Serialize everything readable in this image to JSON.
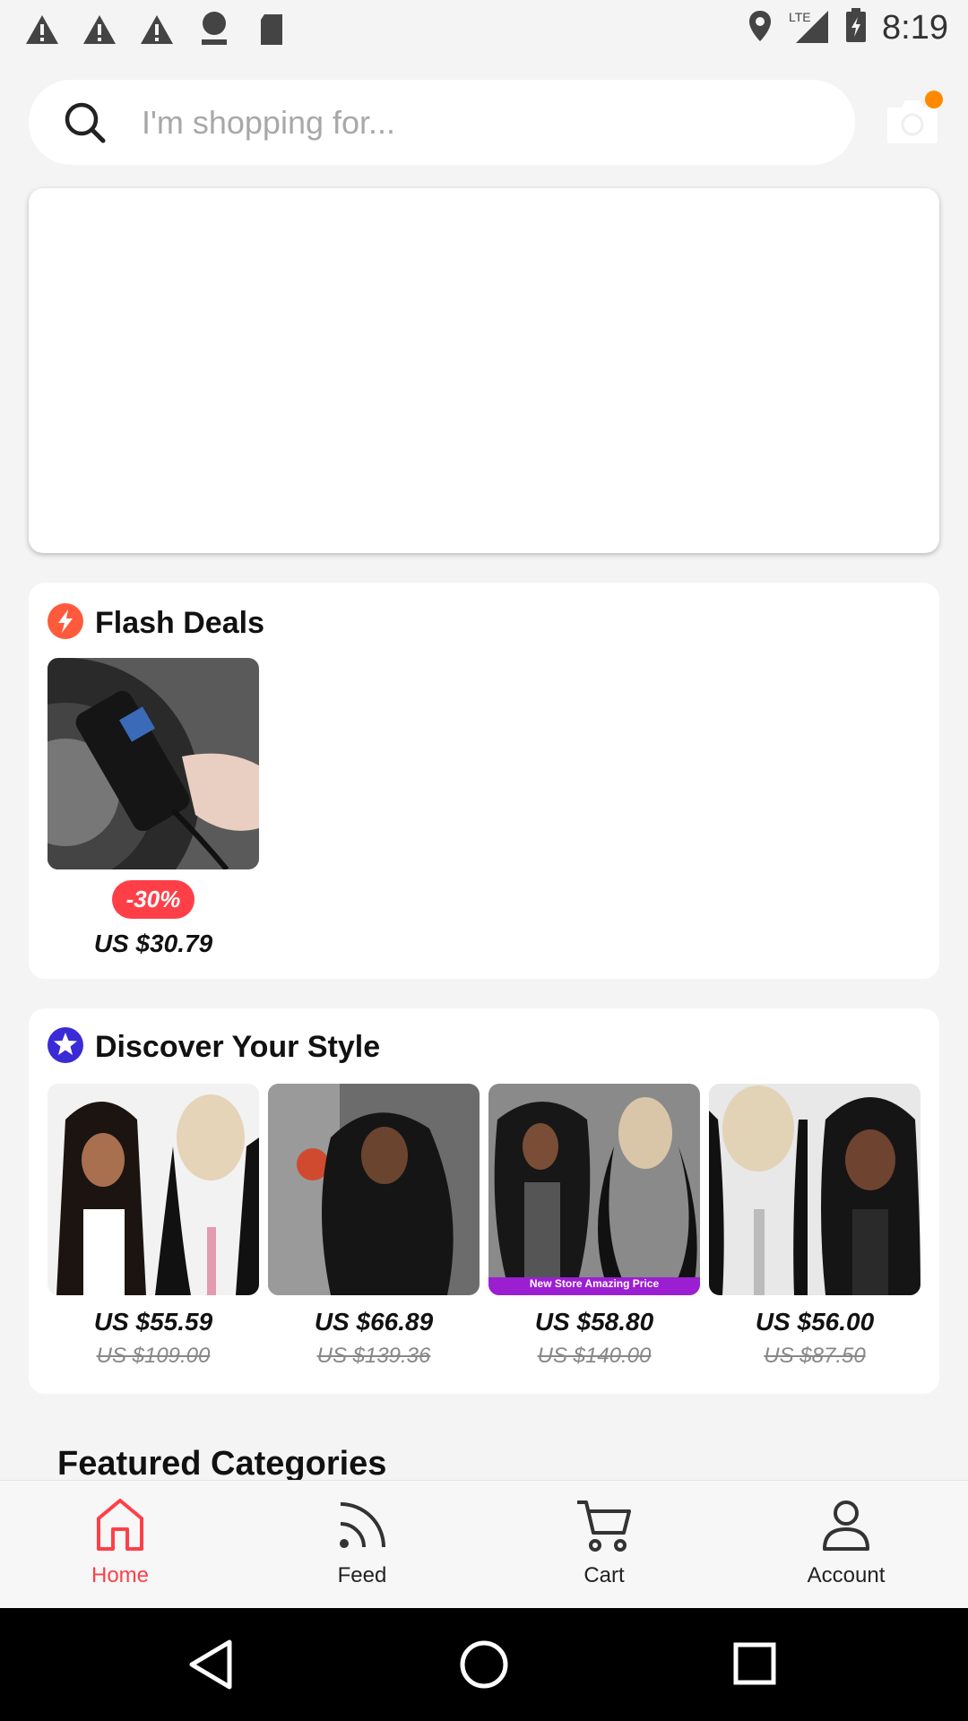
{
  "status_bar": {
    "time": "8:19",
    "network": "LTE",
    "left_icons": [
      "warning-icon",
      "warning-icon",
      "warning-icon",
      "abc-news-icon",
      "sd-card-icon"
    ],
    "right_icons": [
      "location-icon",
      "signal-icon",
      "battery-icon"
    ]
  },
  "search": {
    "placeholder": "I'm shopping for..."
  },
  "flash_deals": {
    "title": "Flash Deals",
    "icon": "lightning-icon",
    "items": [
      {
        "discount": "-30%",
        "price": "US $30.79"
      }
    ]
  },
  "discover": {
    "title": "Discover Your Style",
    "icon": "star-badge-icon",
    "items": [
      {
        "price": "US $55.59",
        "old_price": "US $109.00"
      },
      {
        "price": "US $66.89",
        "old_price": "US $139.36"
      },
      {
        "price": "US $58.80",
        "old_price": "US $140.00",
        "tag": "New Store Amazing Price"
      },
      {
        "price": "US $56.00",
        "old_price": "US $87.50"
      }
    ]
  },
  "featured": {
    "title": "Featured Categories"
  },
  "bottom_nav": {
    "items": [
      {
        "label": "Home",
        "icon": "home-icon",
        "active": true
      },
      {
        "label": "Feed",
        "icon": "feed-icon",
        "active": false
      },
      {
        "label": "Cart",
        "icon": "cart-icon",
        "active": false
      },
      {
        "label": "Account",
        "icon": "account-icon",
        "active": false
      }
    ]
  },
  "colors": {
    "accent": "#ff3f48",
    "flash_icon": "#ff5a3c",
    "discover_icon": "#3a2bd6",
    "camera_dot": "#ff8a00"
  }
}
